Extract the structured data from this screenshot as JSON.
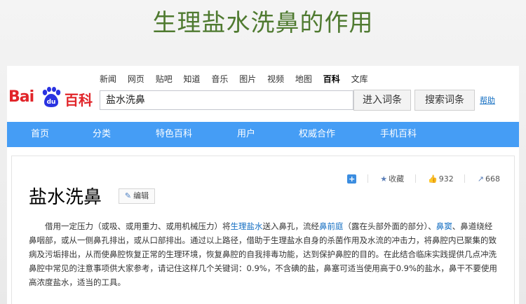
{
  "slide_title": "生理盐水洗鼻的作用",
  "topnav": [
    "新闻",
    "网页",
    "贴吧",
    "知道",
    "音乐",
    "图片",
    "视频",
    "地图",
    "百科",
    "文库"
  ],
  "topnav_active": "百科",
  "logo": {
    "bai": "Bai",
    "du": "du",
    "baike": "百科"
  },
  "search": {
    "value": "盐水洗鼻",
    "enter_label": "进入词条",
    "search_label": "搜索词条",
    "help": "帮助"
  },
  "bluenav": [
    "首页",
    "分类",
    "特色百科",
    "用户",
    "权威合作",
    "手机百科"
  ],
  "actions": {
    "collect": "收藏",
    "likes": "932",
    "shares": "668"
  },
  "lemma": {
    "title": "盐水洗鼻",
    "edit": "编辑"
  },
  "summary": {
    "p1": "借用一定压力（或吸、或用重力、或用机械压力）将",
    "link1": "生理盐水",
    "p2": "送入鼻孔，流经",
    "link2": "鼻前庭",
    "p3": "（露在头部外面的部分）、",
    "link3": "鼻窦",
    "p4": "、鼻道绕经鼻咽部，或从一侧鼻孔排出，或从口部排出。通过以上路径，借助于生理盐水自身的杀菌作用及水流的冲击力，将鼻腔内已聚集的致病及污垢排出，从而使鼻腔恢复正常的生理环境，恢复鼻腔的自我排毒功能，达到保护鼻腔的目的。在此结合临床实践提供几点冲洗鼻腔中常见的注意事项供大家参考，请记住这样几个关键词：0.9%，不含碘的盐，鼻塞可适当使用高于0.9%的盐水，鼻干不要使用高浓度盐水，适当的工具。"
  },
  "colors": {
    "title_green": "#4f7a30",
    "nav_blue": "#459df5",
    "logo_red": "#e1252a",
    "link_blue": "#136ec2"
  }
}
